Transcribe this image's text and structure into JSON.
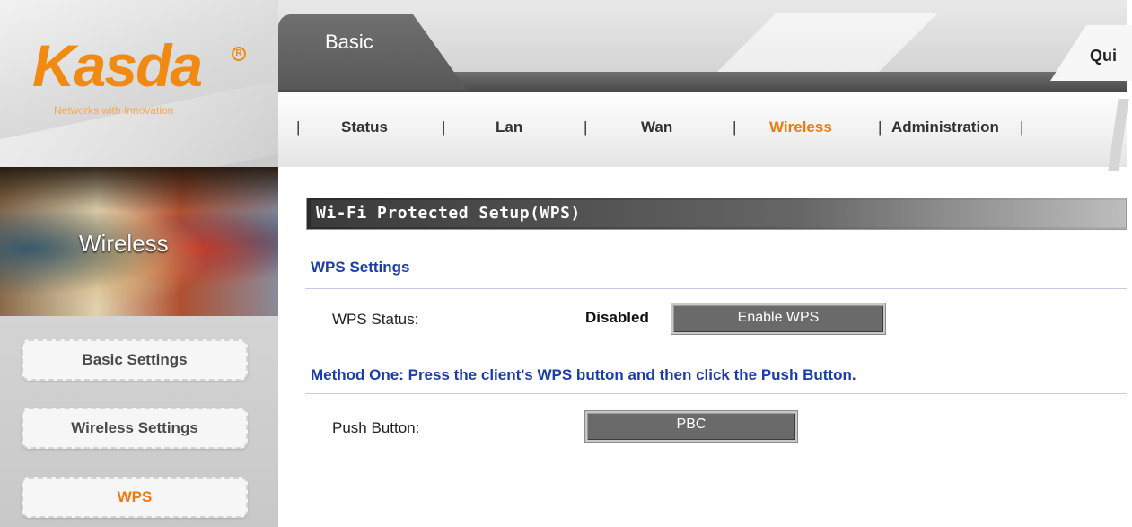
{
  "brand": {
    "logo_text": "Kasda",
    "registered_mark": "R",
    "tagline": "Networks with Innovation",
    "accent_color": "#f07a10"
  },
  "top_tabs": {
    "basic": "Basic",
    "quick": "Qui"
  },
  "subnav": {
    "separator": "|",
    "items": [
      {
        "label": "Status",
        "active": false
      },
      {
        "label": "Lan",
        "active": false
      },
      {
        "label": "Wan",
        "active": false
      },
      {
        "label": "Wireless",
        "active": true
      },
      {
        "label": "Administration",
        "active": false
      }
    ]
  },
  "sidebar": {
    "banner_title": "Wireless",
    "items": [
      {
        "label": "Basic Settings",
        "active": false
      },
      {
        "label": "Wireless Settings",
        "active": false
      },
      {
        "label": "WPS",
        "active": true
      }
    ]
  },
  "content": {
    "title": "Wi-Fi Protected Setup(WPS)",
    "wps_settings_heading": "WPS Settings",
    "wps_status_label": "WPS Status:",
    "wps_status_value": "Disabled",
    "enable_wps_button": "Enable WPS",
    "method_one_heading": "Method One:  Press the client's WPS button and then click the Push Button.",
    "push_button_label": "Push Button:",
    "pbc_button": "PBC"
  }
}
